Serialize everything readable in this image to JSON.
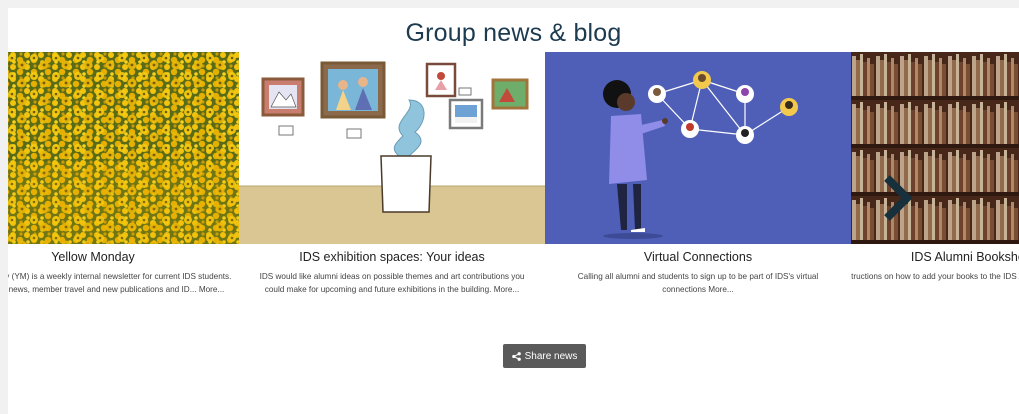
{
  "section": {
    "title": "Group news & blog"
  },
  "cards": [
    {
      "title": "Yellow Monday",
      "description": "Yellow Monday (YM) is a weekly internal newsletter for current IDS students. YM includes news, member travel and new publications and ID...",
      "more": "More..."
    },
    {
      "title": "IDS exhibition spaces: Your ideas",
      "description": "IDS would like alumni ideas on possible themes and art contributions you could make for upcoming and future exhibitions in the building.",
      "more": "More..."
    },
    {
      "title": "Virtual Connections",
      "description": "Calling all alumni and students to sign up to be part of IDS's virtual connections",
      "more": "More..."
    },
    {
      "title": "IDS Alumni Bookshelf",
      "description": "Instructions on how to add your books to the IDS Alumni Bookshelf",
      "more": ""
    }
  ],
  "share_button": {
    "label": "Share news",
    "icon": "share-icon"
  },
  "carousel": {
    "next_icon": "chevron-right-icon"
  },
  "colors": {
    "title": "#1c3a50",
    "virtual_bg": "#4f5fb8",
    "button_bg": "#5a5a5a"
  }
}
